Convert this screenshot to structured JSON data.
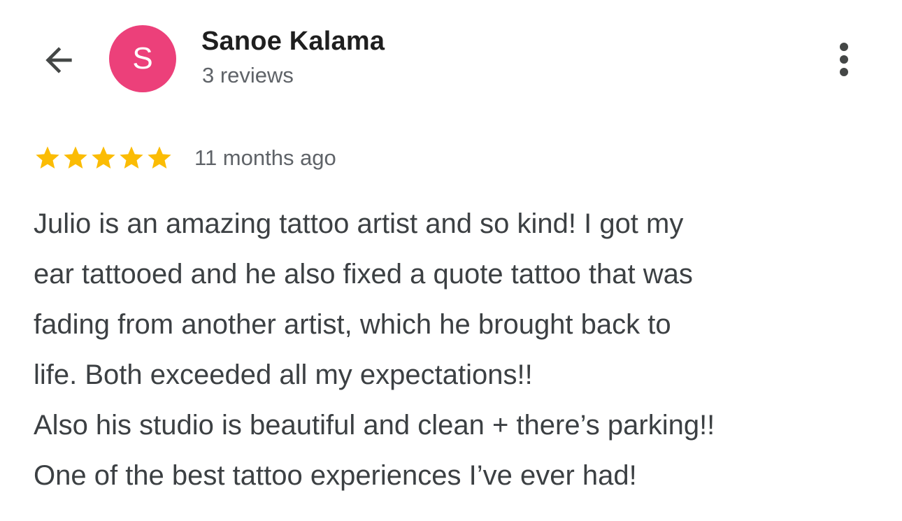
{
  "header": {
    "back_icon": "arrow-back-icon",
    "avatar": {
      "letter": "S",
      "color": "#ec407a"
    },
    "reviewer_name": "Sanoe Kalama",
    "reviews_count": "3 reviews",
    "more_icon": "more-vertical-icon"
  },
  "review": {
    "rating": 5,
    "rating_max": 5,
    "star_color": "#fbbc04",
    "time_ago": "11 months ago",
    "lines": [
      "Julio is an amazing tattoo artist and so kind! I got my",
      "ear tattooed and he also fixed a quote tattoo that was",
      "fading from another artist, which he brought back to",
      "life. Both exceeded all my expectations!!",
      "Also his studio is beautiful and clean + there’s parking!!",
      "One of the best tattoo experiences I’ve ever had!"
    ]
  }
}
